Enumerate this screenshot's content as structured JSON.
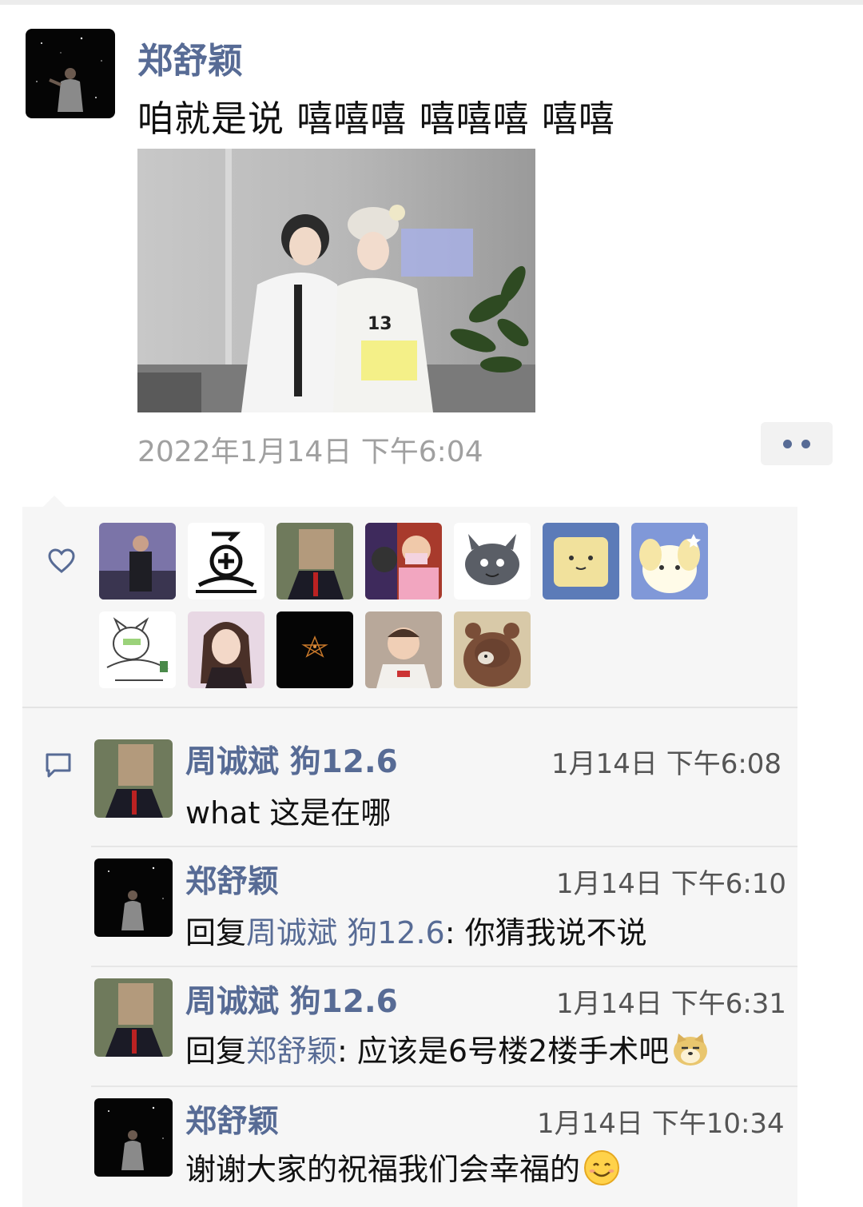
{
  "post": {
    "author": "郑舒颖",
    "text": "咱就是说 嘻嘻嘻 嘻嘻嘻 嘻嘻",
    "timestamp": "2022年1月14日 下午6:04"
  },
  "likes": {
    "icon": "heart-icon",
    "avatars": [
      "avatar-1",
      "avatar-2",
      "avatar-3",
      "avatar-4",
      "avatar-5",
      "avatar-6",
      "avatar-7",
      "avatar-8",
      "avatar-9",
      "avatar-10",
      "avatar-11",
      "avatar-12"
    ]
  },
  "comments": [
    {
      "name": "周诚斌 狗12.6",
      "time": "1月14日 下午6:08",
      "text": "what 这是在哪"
    },
    {
      "name": "郑舒颖",
      "time": "1月14日 下午6:10",
      "reply_prefix": "回复",
      "reply_to": "周诚斌 狗12.6",
      "text": ": 你猜我说不说"
    },
    {
      "name": "周诚斌 狗12.6",
      "time": "1月14日 下午6:31",
      "reply_prefix": "回复",
      "reply_to": "郑舒颖",
      "text": ": 应该是6号楼2楼手术吧",
      "emoji": "doge-emoji"
    },
    {
      "name": "郑舒颖",
      "time": "1月14日 下午10:34",
      "text": "谢谢大家的祝福我们会幸福的",
      "emoji": "smile-emoji"
    }
  ],
  "colors": {
    "link": "#576b95",
    "panel": "#f6f6f6",
    "timestamp": "#a0a0a0"
  }
}
